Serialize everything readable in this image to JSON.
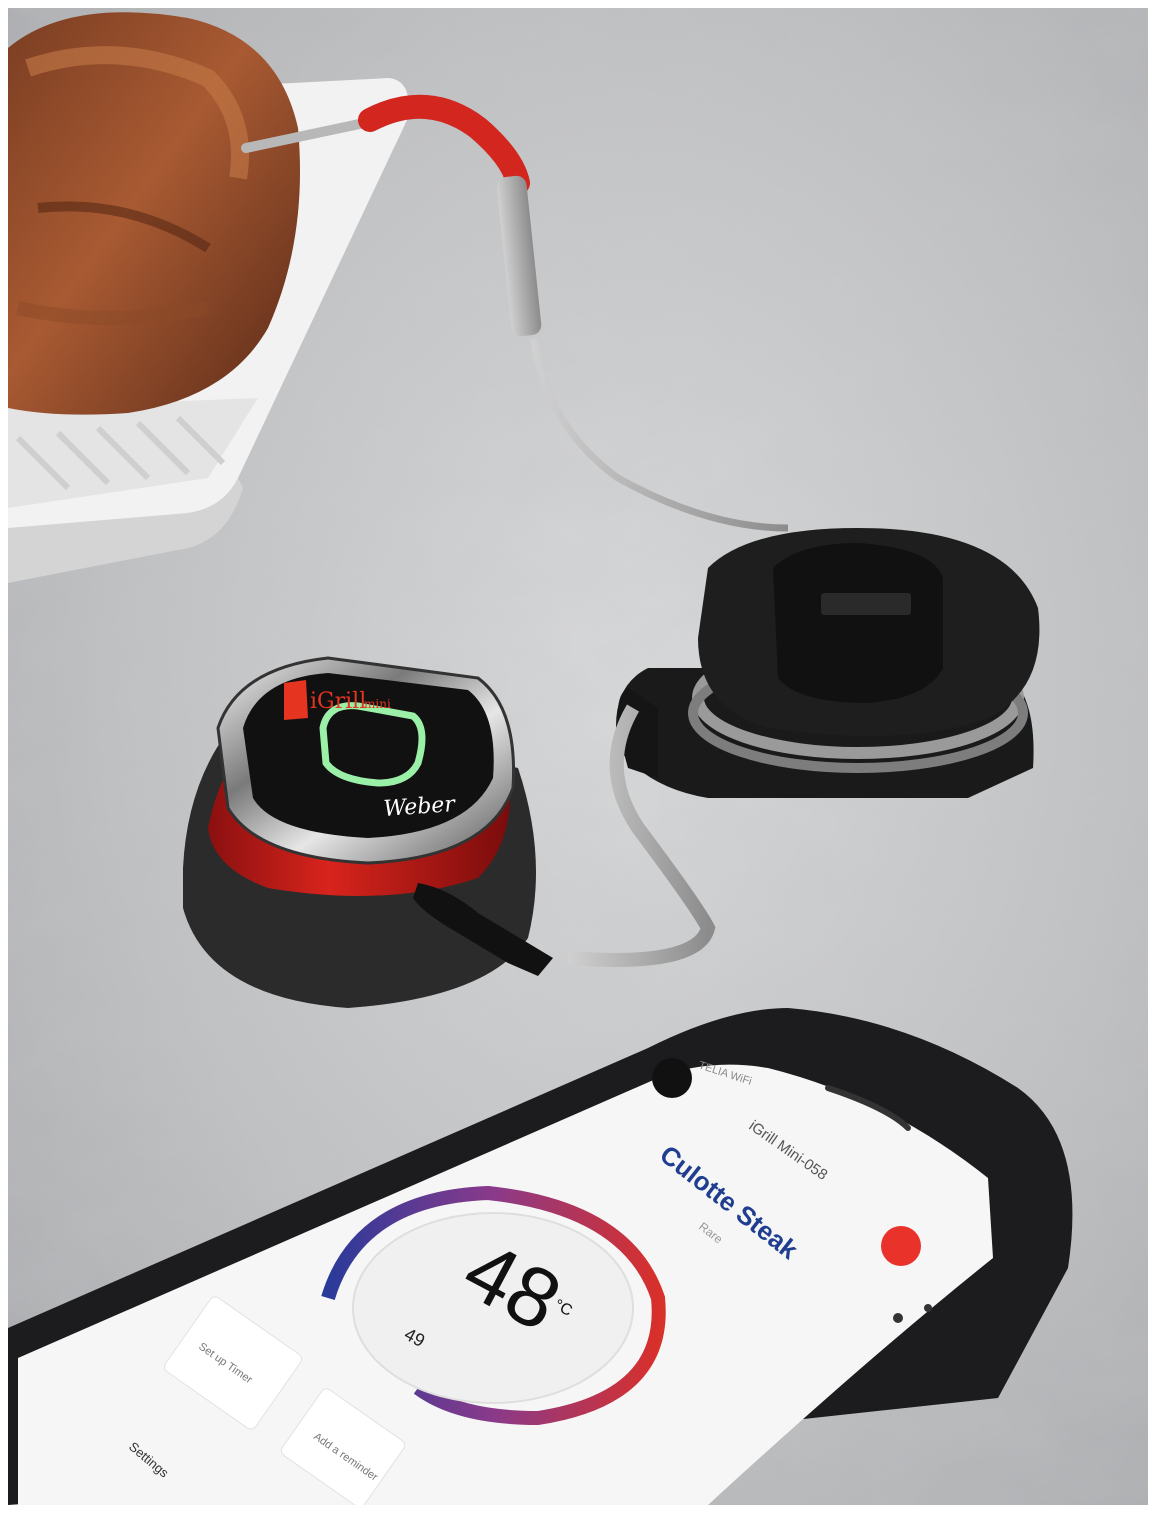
{
  "device": {
    "logo_text": "iGrill",
    "logo_suffix": "mini",
    "brand_text": "Weber"
  },
  "phone": {
    "carrier_text": "TELIA WiFi",
    "device_name": "iGrill Mini-058",
    "meat_title": "Culotte Steak",
    "sub_label": "Rare",
    "temperature": "48",
    "temperature_unit": "°C",
    "target_label": "49",
    "card_left_label": "Set up Timer",
    "card_right_label": "Add a reminder",
    "settings_label": "Settings",
    "colors": {
      "accent_red": "#e8322a",
      "title_blue": "#1f3e8f",
      "ring_blue": "#2a3a9a",
      "ring_red": "#d8302a"
    }
  }
}
